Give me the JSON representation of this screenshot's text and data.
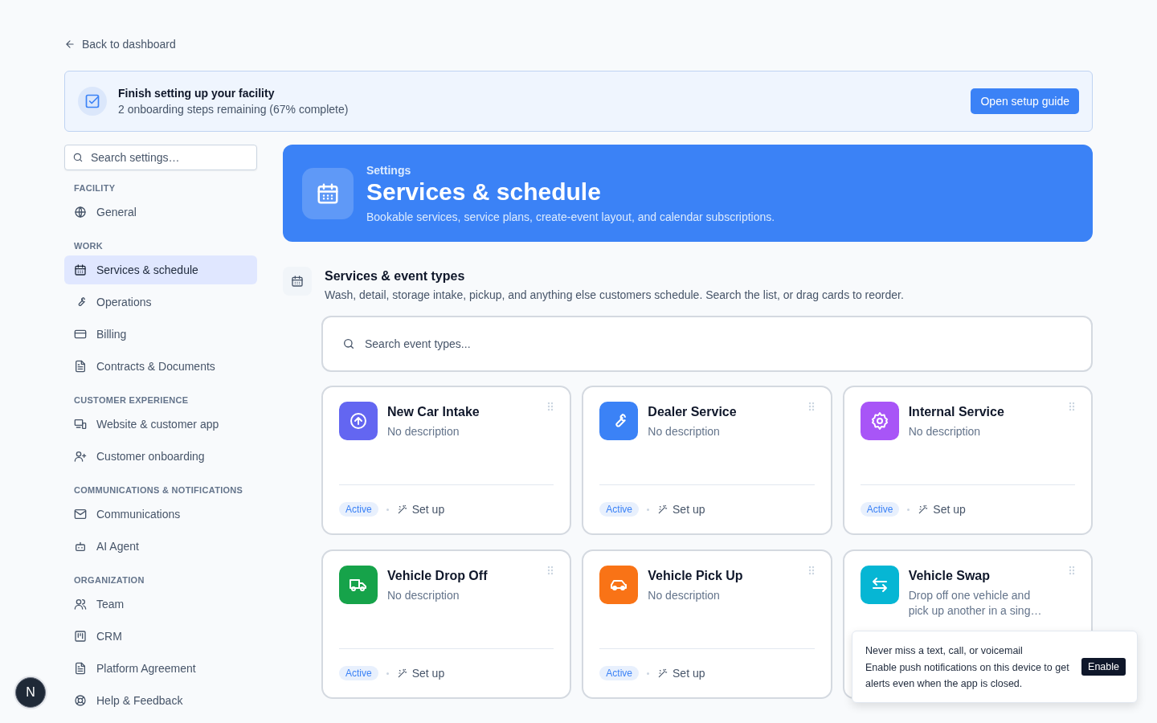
{
  "back_link": "Back to dashboard",
  "setup_banner": {
    "title": "Finish setting up your facility",
    "subtitle": "2 onboarding steps remaining (67% complete)",
    "button": "Open setup guide"
  },
  "sidebar": {
    "search": {
      "placeholder": "Search settings…"
    },
    "sections": [
      {
        "label": "FACILITY",
        "items": [
          {
            "label": "General",
            "selected": false
          }
        ]
      },
      {
        "label": "WORK",
        "items": [
          {
            "label": "Services & schedule",
            "selected": true
          },
          {
            "label": "Operations",
            "selected": false
          },
          {
            "label": "Billing",
            "selected": false
          },
          {
            "label": "Contracts & Documents",
            "selected": false
          }
        ]
      },
      {
        "label": "CUSTOMER EXPERIENCE",
        "items": [
          {
            "label": "Website & customer app",
            "selected": false
          },
          {
            "label": "Customer onboarding",
            "selected": false
          }
        ]
      },
      {
        "label": "COMMUNICATIONS & NOTIFICATIONS",
        "items": [
          {
            "label": "Communications",
            "selected": false
          },
          {
            "label": "AI Agent",
            "selected": false
          }
        ]
      },
      {
        "label": "ORGANIZATION",
        "items": [
          {
            "label": "Team",
            "selected": false
          },
          {
            "label": "CRM",
            "selected": false
          },
          {
            "label": "Platform Agreement",
            "selected": false
          },
          {
            "label": "Help & Feedback",
            "selected": false
          }
        ]
      }
    ]
  },
  "hero": {
    "eyebrow": "Settings",
    "title": "Services & schedule",
    "description": "Bookable services, service plans, create-event layout, and calendar subscriptions."
  },
  "event_types": {
    "title": "Services & event types",
    "description": "Wash, detail, storage intake, pickup, and anything else customers schedule. Search the list, or drag cards to reorder.",
    "search": {
      "placeholder": "Search event types..."
    },
    "cards": [
      {
        "title": "New Car Intake",
        "description": "No description",
        "color": "#6366f1",
        "status": "Active",
        "action": "Set up"
      },
      {
        "title": "Dealer Service",
        "description": "No description",
        "color": "#3b82f6",
        "status": "Active",
        "action": "Set up"
      },
      {
        "title": "Internal Service",
        "description": "No description",
        "color": "#a855f7",
        "status": "Active",
        "action": "Set up"
      },
      {
        "title": "Vehicle Drop Off",
        "description": "No description",
        "color": "#16a34a",
        "status": "Active",
        "action": "Set up"
      },
      {
        "title": "Vehicle Pick Up",
        "description": "No description",
        "color": "#f97316",
        "status": "Active",
        "action": "Set up"
      },
      {
        "title": "Vehicle Swap",
        "description": "Drop off one vehicle and pick up another in a sing…",
        "color": "#06b6d4"
      }
    ]
  },
  "toast": {
    "title": "Never miss a text, call, or voicemail",
    "message": "Enable push notifications on this device to get alerts even when the app is closed.",
    "button": "Enable"
  },
  "avatar": {
    "initial": "N"
  }
}
